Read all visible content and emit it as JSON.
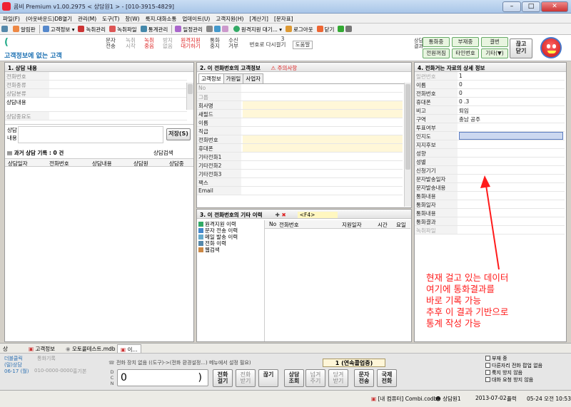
{
  "window": {
    "title": "콤비 Premium v1.00.2975 < 상담원1 > - [010-3915-4829]",
    "min": "–",
    "max": "□",
    "close": "✕"
  },
  "menu": [
    "파일(F)",
    "(아웃바운드)DB열기",
    "관리(M)",
    "도구(T)",
    "창(W)",
    "룩지.대화소통",
    "업데이트(U)",
    "고객지원(H)",
    "[계산기]",
    "[문자표]"
  ],
  "toolbar": [
    "알림판",
    "고객정보",
    "녹취관리",
    "녹취파일",
    "통계관리",
    "일정관리",
    "원격지원 대기...",
    "로그아웃",
    "닫기"
  ],
  "topzone": {
    "no_info": "고객정보에 없는 고객",
    "btn_sms": "문자\n전송",
    "btn_rec_start": "녹취\n시작",
    "btn_rec_on": "녹취\n중음",
    "btn_memo": "방지\n없음",
    "btn_remote": "원격지원\n대기하기",
    "btn_ring": "통화\n중지",
    "btn_receive": "수신\n거부",
    "btn_recall": "번호로 다시걸기",
    "btn_recall_n": "3",
    "btn_help": "도움말",
    "call_status_label": "상담\n결과",
    "status_buttons": [
      "통화중",
      "부재중",
      "결번",
      "전원꺼짐",
      "타인번호",
      "기타(▼)"
    ],
    "hangup": "끊고\n닫기"
  },
  "p1": {
    "title": "1. 상담 내용",
    "rows": [
      "전화번호",
      "전화종류",
      "상담분류",
      "상담내용",
      "상담중요도"
    ],
    "memo_label": "상담\n내용",
    "save": "저장(S)",
    "history_title": "과거 상담 기록 : 0 건",
    "search": "상담검색",
    "cols": [
      "상담일자",
      "전화번호",
      "상담내용",
      "상담원",
      "상담중"
    ]
  },
  "p2": {
    "title": "2. 이 전화번호의 고객정보",
    "warn": "주의사항",
    "tabs": [
      "고객정보",
      "가원일",
      "사업자"
    ],
    "rows": [
      "No",
      "그룹",
      "회사명",
      "새필드",
      "이름",
      "직급",
      "전화번호",
      "휴대폰",
      "기타전화1",
      "기타전화2",
      "기타전화3",
      "팩스",
      "Email"
    ]
  },
  "p3": {
    "title": "3. 이 전화번호의 기타 이력",
    "f4": "<F4>",
    "tree": [
      "원격지원 이력",
      "문자 전송 이력",
      "메일 발송 이력",
      "전화 이력",
      "웹검색"
    ],
    "cols": [
      "No",
      "전화번호",
      "지원일자",
      "시간",
      "요일"
    ]
  },
  "p4": {
    "title": "4. 전화거는 자료의 상세 정보",
    "rows": [
      [
        "일련번호",
        "1"
      ],
      [
        "이름",
        "0"
      ],
      [
        "전화번호",
        "0"
      ],
      [
        "휴대폰",
        "0          .3"
      ],
      [
        "비고",
        "퇴임"
      ],
      [
        "구역",
        "충남 공주"
      ],
      [
        "투표여부",
        ""
      ],
      [
        "인지도",
        ""
      ],
      [
        "지지후보",
        ""
      ],
      [
        "성향",
        ""
      ],
      [
        "성별",
        ""
      ],
      [
        "신청기기",
        ""
      ],
      [
        "문자발송일자",
        ""
      ],
      [
        "문자발송내용",
        ""
      ],
      [
        "통화내용",
        ""
      ],
      [
        "통화일자",
        ""
      ],
      [
        "통화내용",
        ""
      ],
      [
        "통화결과",
        ""
      ],
      [
        "녹취파일",
        ""
      ]
    ]
  },
  "annotation": [
    "현재 걸고 있는 데이터",
    "여기에 통화결과를",
    "바로 기록 가능",
    "추후 이 결과 기반으로",
    "통계 작성 가능"
  ],
  "taskbar": {
    "tabs": [
      "상",
      "고객정보",
      "오토콜테스트.mdb",
      "이..."
    ]
  },
  "bottom": {
    "dbl": "더블클릭",
    "dbl2": "(밀)상담",
    "date": "06-17 (월)",
    "num": "010-0000-0000",
    "name": "홍기본",
    "notice": "전화 장치 없음 ((도구)->(전화 환경설정...) 메뉴에서 설정 필요)",
    "mode": "1 (연속콜업중)",
    "dial": "0",
    "btns": [
      "전화\n걸기",
      "전화\n받기",
      "끊기",
      "상담\n조회",
      "넘겨\n주기",
      "당겨\n받기",
      "문자\n전송",
      "국제\n전화"
    ],
    "checks": [
      "부재 중",
      "다른자리 전화 팝업 없음",
      "룩지 방지 않음",
      "대화 요청 방지 않음"
    ]
  },
  "status": {
    "pc": "[내 컴퓨터] Combi.codb",
    "agent": "상담원1",
    "date": "2013-07-02",
    "mode": "플럭",
    "time": "05-24 오전 10:53"
  },
  "colors": {
    "accent_red": "#ff1a1a",
    "title_blue": "#c9ddf3"
  }
}
